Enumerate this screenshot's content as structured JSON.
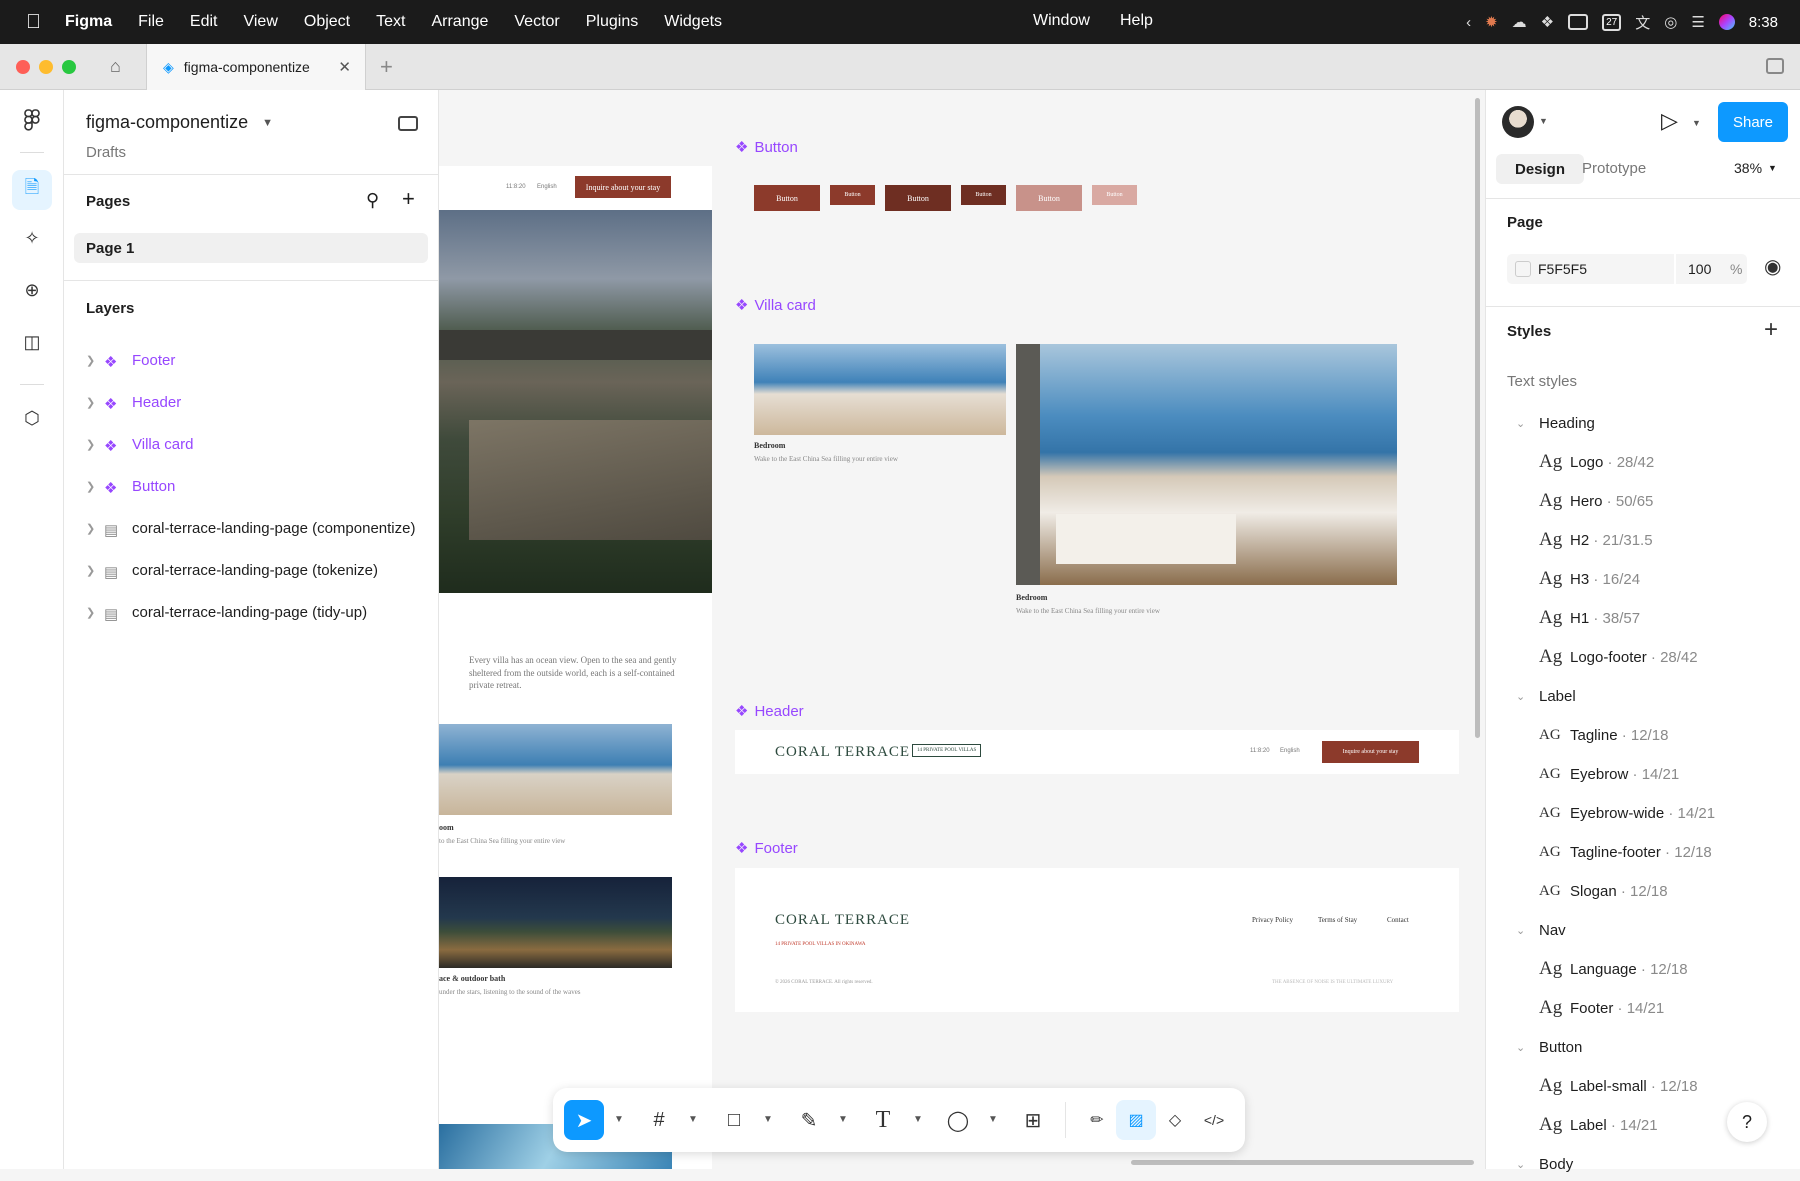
{
  "menubar": {
    "app": "Figma",
    "items": [
      "File",
      "Edit",
      "View",
      "Object",
      "Text",
      "Arrange",
      "Vector",
      "Plugins",
      "Widgets"
    ],
    "items_right": [
      "Window",
      "Help"
    ],
    "calendar_day": "27",
    "time": "8:38"
  },
  "tabbar": {
    "tab_title": "figma-componentize"
  },
  "left_panel": {
    "file_name": "figma-componentize",
    "location": "Drafts",
    "pages_header": "Pages",
    "pages": [
      "Page 1"
    ],
    "layers_header": "Layers",
    "layers": [
      {
        "label": "Footer",
        "kind": "component"
      },
      {
        "label": "Header",
        "kind": "component"
      },
      {
        "label": "Villa card",
        "kind": "component"
      },
      {
        "label": "Button",
        "kind": "component"
      },
      {
        "label": "coral-terrace-landing-page (componentize)",
        "kind": "frame"
      },
      {
        "label": "coral-terrace-landing-page (tokenize)",
        "kind": "frame"
      },
      {
        "label": "coral-terrace-landing-page (tidy-up)",
        "kind": "frame"
      }
    ]
  },
  "canvas": {
    "landing": {
      "nav_time": "11:8:20",
      "nav_lang": "English",
      "nav_cta": "Inquire about your stay",
      "intro": "Every villa has an ocean view. Open to the sea and gently sheltered from the outside world, each is a self-contained private retreat.",
      "card1_title": "oom",
      "card1_desc": "to the East China Sea filling your entire view",
      "card2_title": "ace & outdoor bath",
      "card2_desc": "under the stars, listening to the sound of the waves"
    },
    "button_section": {
      "title": "Button",
      "button_label": "Button",
      "colors": [
        "#8c3a2b",
        "#8c3a2b",
        "#6e2e22",
        "#6e2e22",
        "#c8928a",
        "#d9a9a2"
      ]
    },
    "villa_section": {
      "title": "Villa card",
      "card_title": "Bedroom",
      "card_desc": "Wake to the East China Sea filling your entire view"
    },
    "header_section": {
      "title": "Header",
      "logo": "CORAL TERRACE",
      "badge": "14 PRIVATE POOL VILLAS",
      "time": "11:8:20",
      "lang": "English",
      "cta": "Inquire about your stay"
    },
    "footer_section": {
      "title": "Footer",
      "logo": "CORAL TERRACE",
      "tagline": "14 PRIVATE POOL VILLAS IN OKINAWA",
      "links": [
        "Privacy Policy",
        "Terms of Stay",
        "Contact"
      ],
      "copyright": "© 2026 CORAL TERRACE. All rights reserved.",
      "slogan": "THE ABSENCE OF NOISE IS THE ULTIMATE LUXURY"
    }
  },
  "right_panel": {
    "tabs": [
      "Design",
      "Prototype"
    ],
    "zoom": "38%",
    "share": "Share",
    "page_header": "Page",
    "page_color": "F5F5F5",
    "page_opacity": "100",
    "page_opacity_unit": "%",
    "styles_header": "Styles",
    "text_styles_header": "Text styles",
    "groups": [
      {
        "name": "Heading",
        "styles": [
          {
            "ag": "Ag",
            "name": "Logo",
            "size": " · 28/42"
          },
          {
            "ag": "Ag",
            "name": "Hero",
            "size": " · 50/65"
          },
          {
            "ag": "Ag",
            "name": "H2",
            "size": " · 21/31.5"
          },
          {
            "ag": "Ag",
            "name": "H3",
            "size": " · 16/24"
          },
          {
            "ag": "Ag",
            "name": "H1",
            "size": " · 38/57"
          },
          {
            "ag": "Ag",
            "name": "Logo-footer",
            "size": " · 28/42"
          }
        ]
      },
      {
        "name": "Label",
        "styles": [
          {
            "ag": "AG",
            "name": "Tagline",
            "size": " · 12/18"
          },
          {
            "ag": "AG",
            "name": "Eyebrow",
            "size": " · 14/21"
          },
          {
            "ag": "AG",
            "name": "Eyebrow-wide",
            "size": " · 14/21"
          },
          {
            "ag": "AG",
            "name": "Tagline-footer",
            "size": " · 12/18"
          },
          {
            "ag": "AG",
            "name": "Slogan",
            "size": " · 12/18"
          }
        ]
      },
      {
        "name": "Nav",
        "styles": [
          {
            "ag": "Ag",
            "name": "Language",
            "size": " · 12/18"
          },
          {
            "ag": "Ag",
            "name": "Footer",
            "size": " · 14/21"
          }
        ]
      },
      {
        "name": "Button",
        "styles": [
          {
            "ag": "Ag",
            "name": "Label-small",
            "size": " · 12/18"
          },
          {
            "ag": "Ag",
            "name": "Label",
            "size": " · 14/21"
          }
        ]
      },
      {
        "name": "Body",
        "styles": []
      }
    ],
    "help": "?"
  },
  "colors": {
    "accent": "#0d99ff",
    "component": "#9747ff",
    "brand_button": "#8c3a2b"
  }
}
